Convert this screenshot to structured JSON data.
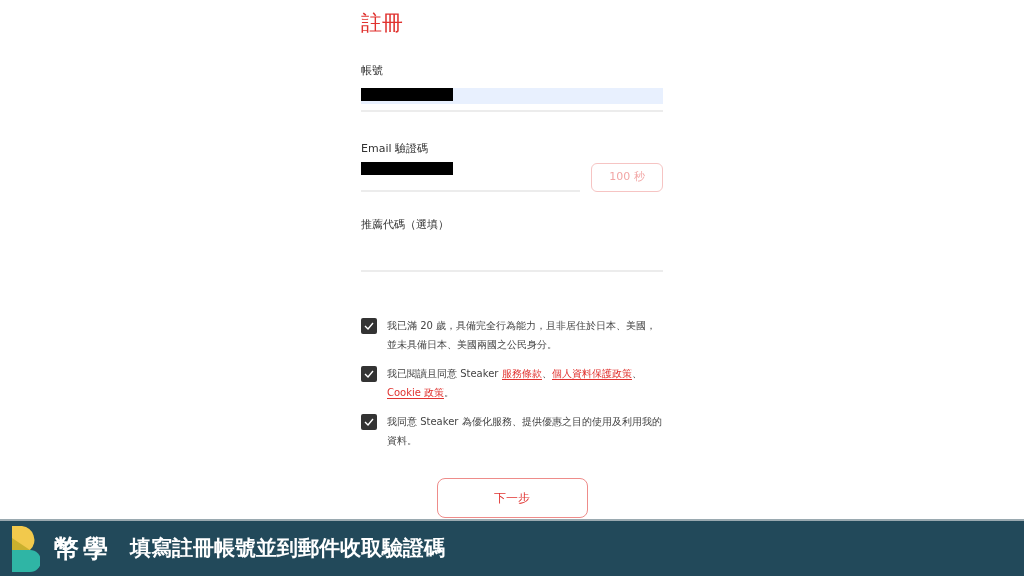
{
  "form": {
    "title": "註冊",
    "fields": [
      {
        "kind": "autofilled",
        "label": "帳號",
        "value_redacted": true
      },
      {
        "kind": "code",
        "label": "Email 驗證碼",
        "value_redacted": true,
        "button": {
          "label": "100 秒",
          "disabled": true
        }
      },
      {
        "kind": "plain",
        "label": "推薦代碼（選填）",
        "value_redacted": false
      }
    ],
    "agreements": [
      {
        "checked": true,
        "parts": [
          {
            "text": "我已滿 20 歲，具備完全行為能力，且非居住於日本、美國，並未具備日本、美國兩國之公民身分。",
            "link": false
          }
        ]
      },
      {
        "checked": true,
        "parts": [
          {
            "text": "我已閱讀且同意 Steaker ",
            "link": false
          },
          {
            "text": "服務條款",
            "link": true
          },
          {
            "text": "、",
            "link": false
          },
          {
            "text": "個人資料保護政策",
            "link": true
          },
          {
            "text": "、",
            "link": false
          },
          {
            "text": "Cookie 政策",
            "link": true
          },
          {
            "text": "。",
            "link": false
          }
        ]
      },
      {
        "checked": true,
        "parts": [
          {
            "text": "我同意 Steaker 為優化服務、提供優惠之目的使用及利用我的資料。",
            "link": false
          }
        ]
      }
    ],
    "submit": "下一步"
  },
  "caption_bar": {
    "brand": "幣學",
    "caption": "填寫註冊帳號並到郵件收取驗證碼"
  }
}
